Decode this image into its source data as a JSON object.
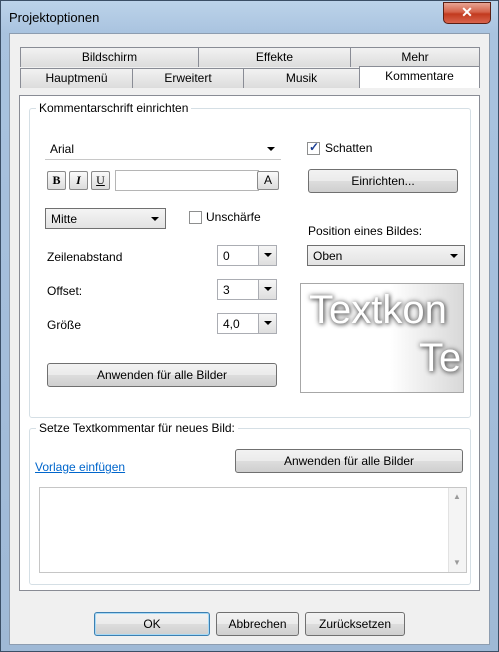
{
  "window": {
    "title": "Projektoptionen"
  },
  "tabs_back": [
    "Bildschirm",
    "Effekte",
    "Mehr"
  ],
  "tabs_front": [
    "Hauptmenü",
    "Erweitert",
    "Musik",
    "Kommentare"
  ],
  "active_tab": "Kommentare",
  "kommentarschrift": {
    "legend": "Kommentarschrift einrichten",
    "font": "Arial",
    "bold": "B",
    "italic": "I",
    "underline": "U",
    "text_value": "",
    "color_button": "A",
    "alignment": "Mitte",
    "blur_label": "Unschärfe",
    "blur_checked": false,
    "line_spacing_label": "Zeilenabstand",
    "line_spacing_value": "0",
    "offset_label": "Offset:",
    "offset_value": "3",
    "size_label": "Größe",
    "size_value": "4,0",
    "apply_all": "Anwenden für alle Bilder",
    "shadow_label": "Schatten",
    "shadow_checked": true,
    "setup_button": "Einrichten...",
    "position_label": "Position eines Bildes:",
    "position_value": "Oben",
    "preview_line1": "Textkon",
    "preview_line2": "Te"
  },
  "neues_bild": {
    "legend": "Setze Textkommentar für neues Bild:",
    "template_link": "Vorlage einfügen",
    "apply_all": "Anwenden für alle Bilder",
    "comment_text": ""
  },
  "footer": {
    "ok": "OK",
    "cancel": "Abbrechen",
    "reset": "Zurücksetzen"
  },
  "colors": {
    "accent": "#0066cc",
    "close": "#c23a1e"
  }
}
